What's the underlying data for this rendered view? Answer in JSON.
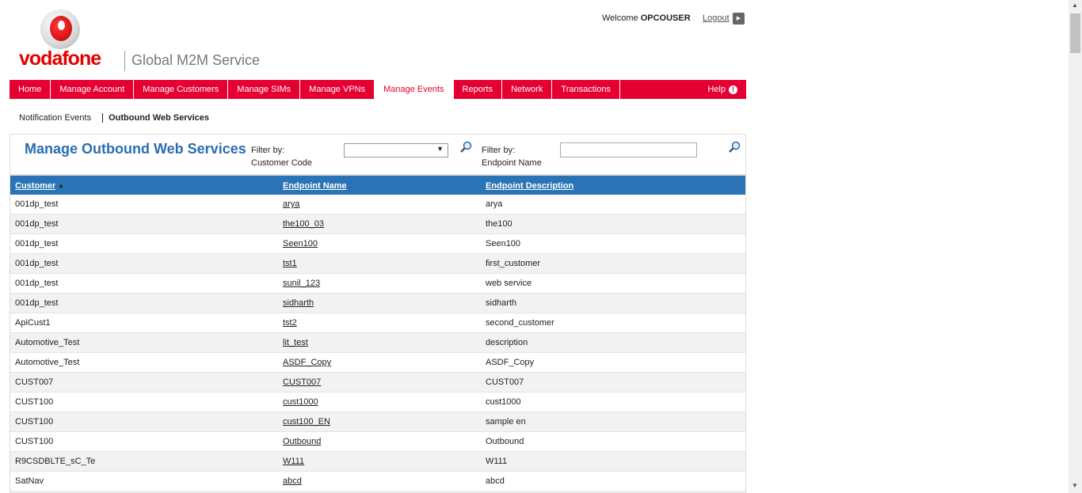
{
  "header": {
    "brand": "vodafone",
    "service": "Global M2M Service",
    "welcome": "Welcome",
    "user": "OPCOUSER",
    "logout": "Logout"
  },
  "nav": {
    "items": [
      "Home",
      "Manage Account",
      "Manage Customers",
      "Manage SIMs",
      "Manage VPNs",
      "Manage Events",
      "Reports",
      "Network",
      "Transactions"
    ],
    "active": "Manage Events",
    "help": "Help"
  },
  "subnav": {
    "items": [
      "Notification Events",
      "Outbound Web Services"
    ],
    "active": "Outbound Web Services"
  },
  "page": {
    "title": "Manage Outbound Web Services",
    "filter1_label1": "Filter by:",
    "filter1_label2": "Customer Code",
    "filter1_value": "",
    "filter2_label1": "Filter by:",
    "filter2_label2": "Endpoint Name",
    "filter2_value": ""
  },
  "table": {
    "headers": [
      "Customer",
      "Endpoint Name",
      "Endpoint Description"
    ],
    "sort": "Customer ascending",
    "rows": [
      [
        "001dp_test",
        "arya",
        "arya"
      ],
      [
        "001dp_test",
        "the100_03",
        "the100"
      ],
      [
        "001dp_test",
        "Seen100",
        "Seen100"
      ],
      [
        "001dp_test",
        "tst1",
        "first_customer"
      ],
      [
        "001dp_test",
        "sunil_123",
        "web service"
      ],
      [
        "001dp_test",
        "sidharth",
        "sidharth"
      ],
      [
        "ApiCust1",
        "tst2",
        "second_customer"
      ],
      [
        "Automotive_Test",
        "lit_test",
        "description"
      ],
      [
        "Automotive_Test",
        "ASDF_Copy",
        "ASDF_Copy"
      ],
      [
        "CUST007",
        "CUST007",
        "CUST007"
      ],
      [
        "CUST100",
        "cust1000",
        "cust1000"
      ],
      [
        "CUST100",
        "cust100_EN",
        "sample en"
      ],
      [
        "CUST100",
        "Outbound",
        "Outbound"
      ],
      [
        "R9CSDBLTE_sC_Te",
        "W111",
        "W111"
      ],
      [
        "SatNav",
        "abcd",
        "abcd"
      ]
    ]
  },
  "colors": {
    "brand_red": "#e60000",
    "nav_red": "#e60032",
    "header_blue": "#2a74b6",
    "title_blue": "#2a6db0"
  }
}
